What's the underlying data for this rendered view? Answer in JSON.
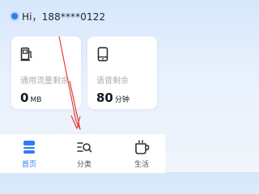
{
  "greeting": {
    "text": "Hi，188****0122"
  },
  "cards": {
    "flow": {
      "icon": "fuel-pump-icon",
      "label": "通用流量剩余",
      "value": "0",
      "unit": "MB"
    },
    "voice": {
      "icon": "phone-icon",
      "label": "语音剩余",
      "value": "80",
      "unit": "分钟"
    }
  },
  "tabbar": {
    "items": [
      {
        "label": "首页",
        "icon": "home-icon",
        "active": true
      },
      {
        "label": "分类",
        "icon": "category-search-icon",
        "active": false
      },
      {
        "label": "生活",
        "icon": "cup-icon",
        "active": false
      }
    ]
  },
  "colors": {
    "accent": "#2f7cf6",
    "annotation": "#e0322c",
    "label_gray": "#a7acb5",
    "text_dark": "#15191f"
  }
}
